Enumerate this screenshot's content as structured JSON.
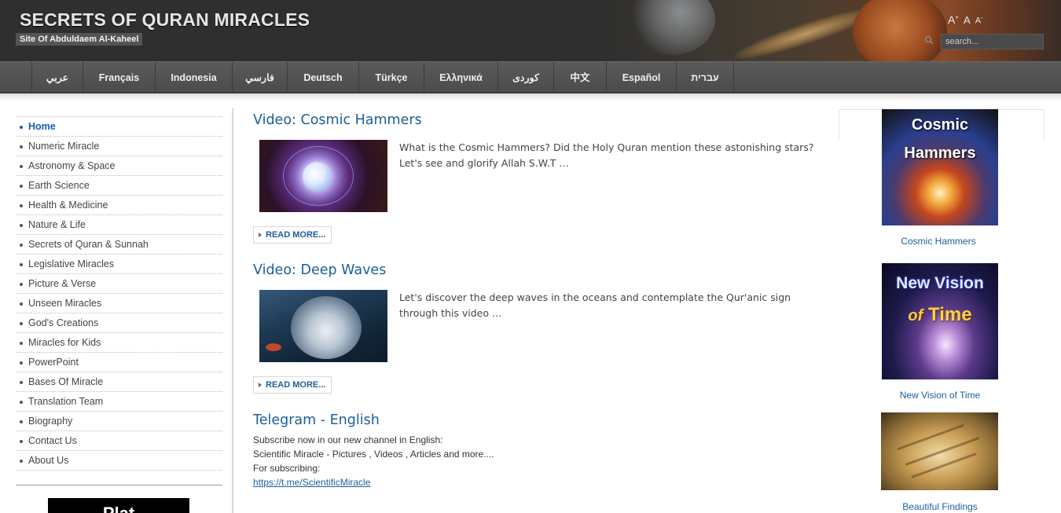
{
  "header": {
    "site_title": "SECRETS OF QURAN MIRACLES",
    "slogan": "Site Of Abduldaem Al-Kaheel",
    "font_tools": {
      "increase": "A",
      "increase_sup": "+",
      "default": "A",
      "decrease": "A",
      "decrease_sup": "-"
    },
    "search": {
      "placeholder": "search..."
    }
  },
  "languages": [
    "عربي",
    "Français",
    "Indonesia",
    "فارسي",
    "Deutsch",
    "Türkçe",
    "Ελληνικά",
    "كوردی",
    "中文",
    "Español",
    "עברית"
  ],
  "sidebar": {
    "items": [
      "Home",
      "Numeric Miracle",
      "Astronomy & Space",
      "Earth Science",
      "Health & Medicine",
      "Nature & Life",
      "Secrets of Quran & Sunnah",
      "Legislative Miracles",
      "Picture & Verse",
      "Unseen Miracles",
      "God's Creations",
      "Miracles for Kids",
      "PowerPoint",
      "Bases Of Miracle",
      "Translation Team",
      "Biography",
      "Contact Us",
      "About Us"
    ],
    "active_index": 0,
    "banner_text": "Plat"
  },
  "articles": [
    {
      "title": "Video: Cosmic Hammers",
      "text": "What is the Cosmic Hammers? Did the Holy Quran mention these astonishing stars? Let's see and glorify Allah S.W.T …",
      "read_more": "READ MORE..."
    },
    {
      "title": "Video: Deep Waves",
      "text": "Let's discover the deep waves in the oceans and contemplate the Qur'anic sign through this video …",
      "read_more": "READ MORE..."
    }
  ],
  "telegram": {
    "title": "Telegram - English",
    "line1": "Subscribe now in our new channel in English:",
    "line2": "Scientific Miracle - Pictures , Videos , Articles and more....",
    "line3": "For subscribing:",
    "link": "https://t.me/ScientificMiracle"
  },
  "right_cards": [
    {
      "image_line1": "Cosmic",
      "image_line2": "Hammers",
      "caption": "Cosmic Hammers"
    },
    {
      "image_line1": "New Vision",
      "image_line2_a": "of",
      "image_line2_b": "Time",
      "caption": "New Vision of Time"
    },
    {
      "caption": "Beautiful Findings"
    }
  ]
}
